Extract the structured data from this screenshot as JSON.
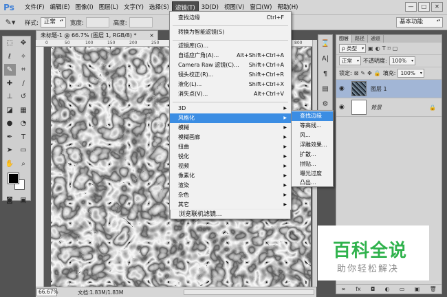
{
  "app": {
    "logo": "Ps"
  },
  "menubar": {
    "items": [
      "文件(F)",
      "编辑(E)",
      "图像(I)",
      "图层(L)",
      "文字(Y)",
      "选择(S)",
      "滤镜(T)",
      "3D(D)",
      "视图(V)",
      "窗口(W)",
      "帮助(H)"
    ],
    "active_index": 6
  },
  "window_controls": {
    "minimize": "—",
    "restore": "□",
    "close": "✕"
  },
  "options_bar": {
    "style_label": "样式:",
    "style_value": "正常",
    "width_label": "宽度:",
    "height_label": "高度:",
    "workspace": "基本功能"
  },
  "document": {
    "tab_title": "未标题-1 @ 66.7% (图层 1, RGB/8) *",
    "tab_close": "×",
    "ruler_labels": [
      "0",
      "50",
      "100",
      "150",
      "200",
      "250",
      "300",
      "350",
      "400",
      "450",
      "500",
      "550",
      "800"
    ]
  },
  "status_bar": {
    "zoom": "66.67%",
    "doc_info": "文档:1.83M/1.83M"
  },
  "filter_menu": {
    "items": [
      {
        "label": "查找边缘",
        "shortcut": "Ctrl+F"
      },
      {
        "label": "转换为智能滤镜(S)",
        "shortcut": ""
      },
      {
        "label": "滤镜库(G)...",
        "shortcut": ""
      },
      {
        "label": "自适应广角(A)...",
        "shortcut": "Alt+Shift+Ctrl+A"
      },
      {
        "label": "Camera Raw 滤镜(C)...",
        "shortcut": "Shift+Ctrl+A"
      },
      {
        "label": "镜头校正(R)...",
        "shortcut": "Shift+Ctrl+R"
      },
      {
        "label": "液化(L)...",
        "shortcut": "Shift+Ctrl+X"
      },
      {
        "label": "消失点(V)...",
        "shortcut": "Alt+Ctrl+V"
      },
      {
        "label": "3D",
        "shortcut": ""
      },
      {
        "label": "风格化",
        "shortcut": ""
      },
      {
        "label": "模糊",
        "shortcut": ""
      },
      {
        "label": "模糊画廊",
        "shortcut": ""
      },
      {
        "label": "扭曲",
        "shortcut": ""
      },
      {
        "label": "锐化",
        "shortcut": ""
      },
      {
        "label": "视频",
        "shortcut": ""
      },
      {
        "label": "像素化",
        "shortcut": ""
      },
      {
        "label": "渲染",
        "shortcut": ""
      },
      {
        "label": "杂色",
        "shortcut": ""
      },
      {
        "label": "其它",
        "shortcut": ""
      },
      {
        "label": "浏览联机滤镜...",
        "shortcut": ""
      }
    ],
    "highlighted": "风格化"
  },
  "stylize_submenu": {
    "items": [
      "查找边缘",
      "等高线...",
      "风...",
      "浮雕效果...",
      "扩散...",
      "拼贴...",
      "曝光过度",
      "凸出..."
    ],
    "highlighted": "查找边缘"
  },
  "layers_panel": {
    "tabs": [
      "图层",
      "路径",
      "通道"
    ],
    "filter_kind": "ρ 类型",
    "blend_mode": "正常",
    "opacity_label": "不透明度:",
    "opacity_value": "100%",
    "lock_label": "锁定:",
    "fill_label": "填充:",
    "fill_value": "100%",
    "layers": [
      {
        "name": "图层 1",
        "selected": true
      },
      {
        "name": "背景",
        "selected": false,
        "locked": true
      }
    ]
  },
  "watermark": {
    "title": "百科全说",
    "subtitle": "助你轻松解决"
  },
  "colors": {
    "accent": "#3b8de3",
    "watermark_green": "#2fb24c",
    "layer_selected": "#a2b6d6"
  }
}
